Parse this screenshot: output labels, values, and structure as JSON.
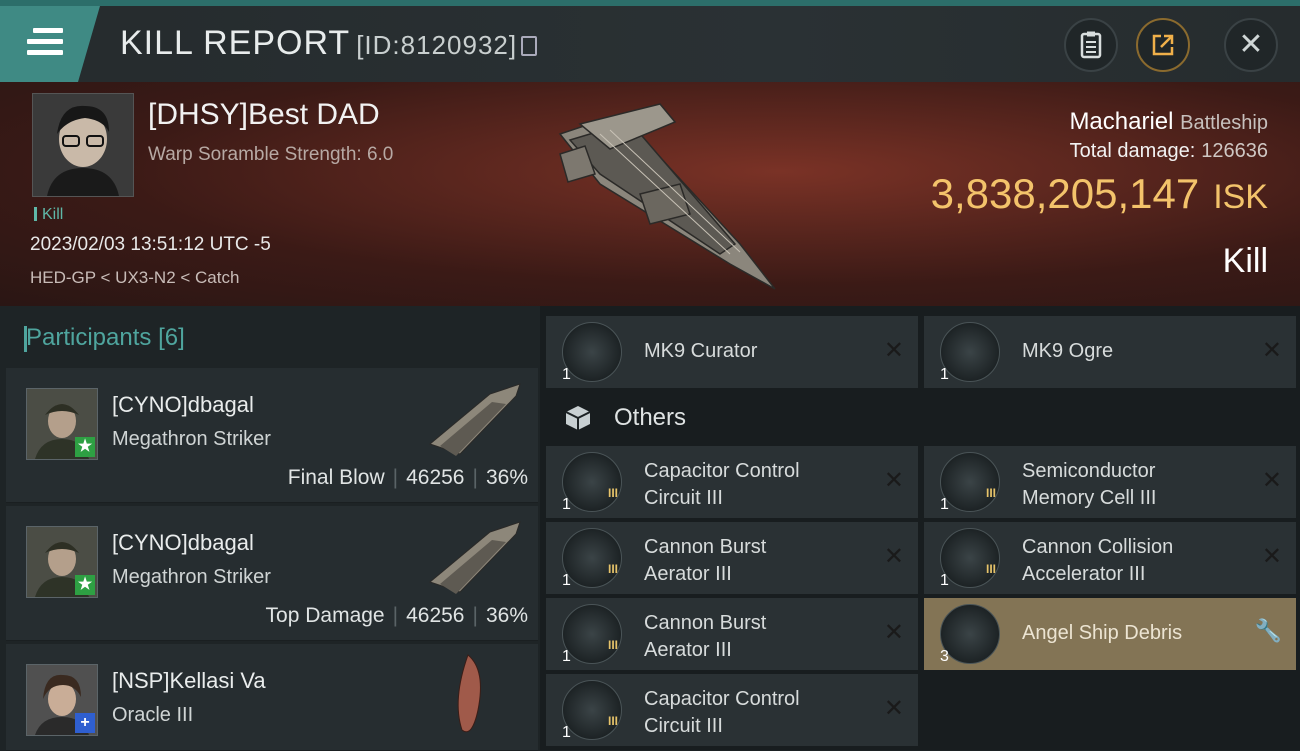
{
  "header": {
    "title": "KILL REPORT",
    "report_id": "[ID:8120932]",
    "buttons": [
      "clipboard-icon",
      "share-icon",
      "close-icon"
    ]
  },
  "victim": {
    "name": "[DHSY]Best DAD",
    "scramble": "Warp Soramble Strength: 6.0",
    "tag": "Kill",
    "datetime": "2023/02/03 13:51:12 UTC -5",
    "location": "HED-GP < UX3-N2 < Catch",
    "ship_name": "Machariel",
    "ship_class": "Battleship",
    "total_damage_label": "Total damage:",
    "total_damage": "126636",
    "isk_value": "3,838,205,147",
    "isk_unit": "ISK",
    "result": "Kill"
  },
  "participants": {
    "title": "Participants",
    "count": "[6]",
    "rows": [
      {
        "name": "[CYNO]dbagal",
        "ship": "Megathron Striker",
        "label": "Final Blow",
        "damage": "46256",
        "percent": "36%",
        "badge": "★"
      },
      {
        "name": "[CYNO]dbagal",
        "ship": "Megathron Striker",
        "label": "Top Damage",
        "damage": "46256",
        "percent": "36%",
        "badge": "★"
      },
      {
        "name": "[NSP]Kellasi Va",
        "ship": "Oracle III",
        "badge": "+"
      }
    ]
  },
  "drones": [
    {
      "name": "MK9  Curator",
      "qty": "1"
    },
    {
      "name": "MK9  Ogre",
      "qty": "1"
    }
  ],
  "others_label": "Others",
  "others": [
    {
      "line1": "Capacitor Control",
      "line2": "Circuit III",
      "qty": "1",
      "tier": "III"
    },
    {
      "line1": "Semiconductor",
      "line2": "Memory Cell III",
      "qty": "1",
      "tier": "III"
    },
    {
      "line1": "Cannon Burst",
      "line2": "Aerator III",
      "qty": "1",
      "tier": "III"
    },
    {
      "line1": "Cannon Collision",
      "line2": "Accelerator III",
      "qty": "1",
      "tier": "III"
    },
    {
      "line1": "Cannon Burst",
      "line2": "Aerator III",
      "qty": "1",
      "tier": "III"
    },
    {
      "line1": "Angel Ship Debris",
      "line2": "",
      "qty": "3"
    },
    {
      "line1": "Capacitor Control",
      "line2": "Circuit III",
      "qty": "1",
      "tier": "III"
    }
  ],
  "colors": {
    "accent": "#3f8a84",
    "isk": "#f3c36b",
    "highlight": "#837455"
  }
}
